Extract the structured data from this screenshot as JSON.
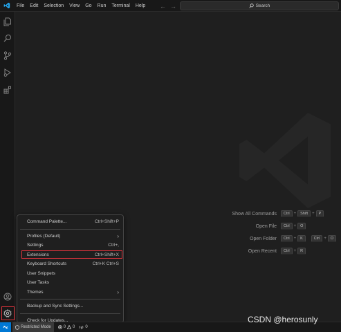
{
  "menubar": {
    "items": [
      "File",
      "Edit",
      "Selection",
      "View",
      "Go",
      "Run",
      "Terminal",
      "Help"
    ]
  },
  "search": {
    "label": "Search"
  },
  "shortcuts": [
    {
      "label": "Show All Commands",
      "keys": [
        [
          "Ctrl",
          "Shift",
          "P"
        ]
      ]
    },
    {
      "label": "Open File",
      "keys": [
        [
          "Ctrl",
          "O"
        ]
      ]
    },
    {
      "label": "Open Folder",
      "keys": [
        [
          "Ctrl",
          "K"
        ],
        [
          "Ctrl",
          "O"
        ]
      ]
    },
    {
      "label": "Open Recent",
      "keys": [
        [
          "Ctrl",
          "R"
        ]
      ]
    }
  ],
  "gear_menu": {
    "command_palette": {
      "label": "Command Palette...",
      "shortcut": "Ctrl+Shift+P"
    },
    "profiles": {
      "label": "Profiles (Default)"
    },
    "settings": {
      "label": "Settings",
      "shortcut": "Ctrl+,"
    },
    "extensions": {
      "label": "Extensions",
      "shortcut": "Ctrl+Shift+X"
    },
    "keyboard_shortcuts": {
      "label": "Keyboard Shortcuts",
      "shortcut": "Ctrl+K Ctrl+S"
    },
    "user_snippets": {
      "label": "User Snippets"
    },
    "user_tasks": {
      "label": "User Tasks"
    },
    "themes": {
      "label": "Themes"
    },
    "backup_sync": {
      "label": "Backup and Sync Settings..."
    },
    "check_updates": {
      "label": "Check for Updates..."
    }
  },
  "statusbar": {
    "restricted_mode": "Restricted Mode",
    "errors": "0",
    "warnings": "0",
    "ports": "0"
  },
  "credit": "CSDN @herosunly",
  "colors": {
    "accent": "#0078d4",
    "highlight": "#e0343d",
    "background": "#1f1f1f"
  }
}
